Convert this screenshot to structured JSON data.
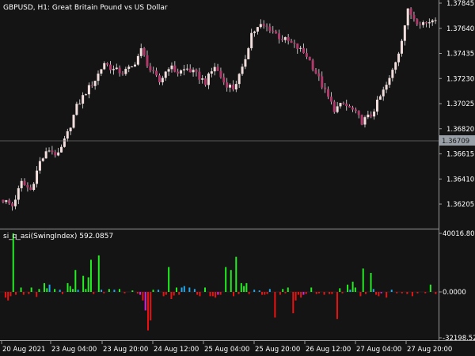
{
  "window": {
    "symbol_title": "GBPUSD, H1:  Great Britain Pound vs US Dollar",
    "indicator_title": "si_q_asi(SwingIndex) 592.0857"
  },
  "colors": {
    "background": "#141414",
    "separator": "#9a9a9a",
    "bull_candle": "#f3dede",
    "bear_candle": "#b0386a",
    "wick": "#e8e8e8",
    "current_price_box": "#9aa0a8",
    "hist_green": "#22ee22",
    "hist_red": "#ee1111",
    "hist_magenta": "#dd22dd",
    "hist_blue": "#22a8ee"
  },
  "price_axis": {
    "labels": [
      "1.37845",
      "1.37640",
      "1.37435",
      "1.37230",
      "1.37025",
      "1.36820",
      "1.36615",
      "1.36410",
      "1.36205"
    ],
    "current_price": "1.36709"
  },
  "indicator_axis": {
    "labels": [
      "40016.80",
      "0.0000",
      "-32198.52"
    ]
  },
  "time_axis": {
    "labels": [
      "20 Aug 2021",
      "23 Aug 04:00",
      "23 Aug 20:00",
      "24 Aug 12:00",
      "25 Aug 04:00",
      "25 Aug 20:00",
      "26 Aug 12:00",
      "27 Aug 04:00",
      "27 Aug 20:00"
    ]
  },
  "chart_data": [
    {
      "type": "candlestick",
      "title": "GBPUSD, H1: Great Britain Pound vs US Dollar",
      "ylim": [
        1.3608,
        1.379
      ],
      "y_ticks": [
        1.37845,
        1.3764,
        1.37435,
        1.3723,
        1.37025,
        1.3682,
        1.36615,
        1.3641,
        1.36205
      ],
      "current_price": 1.36709,
      "close_path": [
        [
          0,
          1.3624
        ],
        [
          3,
          1.3619
        ],
        [
          6,
          1.3638
        ],
        [
          9,
          1.3632
        ],
        [
          12,
          1.3655
        ],
        [
          15,
          1.3665
        ],
        [
          18,
          1.366
        ],
        [
          21,
          1.3678
        ],
        [
          24,
          1.37
        ],
        [
          27,
          1.3712
        ],
        [
          30,
          1.3722
        ],
        [
          33,
          1.3736
        ],
        [
          36,
          1.373
        ],
        [
          39,
          1.3728
        ],
        [
          42,
          1.3732
        ],
        [
          45,
          1.3746
        ],
        [
          48,
          1.373
        ],
        [
          51,
          1.372
        ],
        [
          54,
          1.3733
        ],
        [
          57,
          1.3728
        ],
        [
          60,
          1.3731
        ],
        [
          63,
          1.3726
        ],
        [
          66,
          1.372
        ],
        [
          69,
          1.3733
        ],
        [
          72,
          1.372
        ],
        [
          75,
          1.3715
        ],
        [
          78,
          1.373
        ],
        [
          81,
          1.376
        ],
        [
          84,
          1.3766
        ],
        [
          87,
          1.3764
        ],
        [
          90,
          1.3757
        ],
        [
          93,
          1.3753
        ],
        [
          96,
          1.3748
        ],
        [
          99,
          1.3742
        ],
        [
          102,
          1.3728
        ],
        [
          105,
          1.3712
        ],
        [
          108,
          1.3698
        ],
        [
          111,
          1.3702
        ],
        [
          114,
          1.3697
        ],
        [
          117,
          1.3688
        ],
        [
          120,
          1.3693
        ],
        [
          123,
          1.3708
        ],
        [
          126,
          1.3722
        ],
        [
          129,
          1.3745
        ],
        [
          132,
          1.3778
        ],
        [
          135,
          1.377
        ],
        [
          138,
          1.3768
        ],
        [
          141,
          1.3773
        ]
      ],
      "candle_count": 142
    },
    {
      "type": "bar",
      "title": "si_q_asi(SwingIndex) 592.0857",
      "ylim": [
        -32198.52,
        40016.8
      ],
      "y_ticks": [
        40016.8,
        0.0,
        -32198.52
      ],
      "bars": [
        [
          1,
          -4000,
          "red"
        ],
        [
          2,
          -6000,
          "red"
        ],
        [
          3,
          -3000,
          "red"
        ],
        [
          4,
          40016,
          "green"
        ],
        [
          5,
          -2000,
          "red"
        ],
        [
          7,
          3000,
          "green"
        ],
        [
          8,
          -2000,
          "red"
        ],
        [
          10,
          -1500,
          "red"
        ],
        [
          11,
          3000,
          "green"
        ],
        [
          13,
          -3500,
          "red"
        ],
        [
          14,
          2000,
          "green"
        ],
        [
          16,
          6000,
          "green"
        ],
        [
          17,
          2500,
          "green"
        ],
        [
          18,
          5000,
          "blue"
        ],
        [
          20,
          2000,
          "green"
        ],
        [
          22,
          1500,
          "blue"
        ],
        [
          23,
          -1500,
          "red"
        ],
        [
          25,
          6000,
          "green"
        ],
        [
          26,
          4000,
          "green"
        ],
        [
          27,
          2000,
          "green"
        ],
        [
          28,
          15000,
          "green"
        ],
        [
          29,
          1500,
          "blue"
        ],
        [
          31,
          11000,
          "green"
        ],
        [
          32,
          2000,
          "green"
        ],
        [
          33,
          10000,
          "green"
        ],
        [
          34,
          22000,
          "green"
        ],
        [
          35,
          -1500,
          "red"
        ],
        [
          37,
          25000,
          "green"
        ],
        [
          38,
          1500,
          "blue"
        ],
        [
          39,
          -1000,
          "red"
        ],
        [
          41,
          2000,
          "green"
        ],
        [
          43,
          1500,
          "blue"
        ],
        [
          45,
          2000,
          "green"
        ],
        [
          47,
          -1000,
          "red"
        ],
        [
          50,
          1000,
          "green"
        ],
        [
          52,
          -1200,
          "red"
        ],
        [
          53,
          -2000,
          "magenta"
        ],
        [
          54,
          -6000,
          "red"
        ],
        [
          55,
          -13000,
          "magenta"
        ],
        [
          56,
          -27000,
          "red"
        ],
        [
          57,
          -20000,
          "red"
        ],
        [
          58,
          1500,
          "green"
        ],
        [
          60,
          1500,
          "blue"
        ],
        [
          62,
          -3000,
          "red"
        ],
        [
          63,
          -2000,
          "red"
        ],
        [
          64,
          17000,
          "green"
        ],
        [
          65,
          -5000,
          "red"
        ],
        [
          66,
          -2500,
          "red"
        ],
        [
          67,
          3000,
          "green"
        ],
        [
          68,
          -2000,
          "red"
        ],
        [
          69,
          3000,
          "blue"
        ],
        [
          70,
          4000,
          "blue"
        ],
        [
          72,
          3000,
          "blue"
        ],
        [
          74,
          2000,
          "blue"
        ],
        [
          75,
          -2000,
          "red"
        ],
        [
          76,
          -3000,
          "red"
        ],
        [
          78,
          3000,
          "green"
        ],
        [
          80,
          -3000,
          "red"
        ],
        [
          81,
          -3000,
          "red"
        ],
        [
          82,
          -4000,
          "red"
        ],
        [
          83,
          -2000,
          "magenta"
        ],
        [
          84,
          -2000,
          "red"
        ],
        [
          86,
          17000,
          "green"
        ],
        [
          88,
          15000,
          "green"
        ],
        [
          89,
          -3000,
          "red"
        ],
        [
          90,
          24000,
          "green"
        ],
        [
          91,
          -1500,
          "red"
        ],
        [
          92,
          6000,
          "green"
        ],
        [
          93,
          4000,
          "green"
        ],
        [
          94,
          6000,
          "green"
        ],
        [
          95,
          -1500,
          "red"
        ],
        [
          97,
          1500,
          "blue"
        ],
        [
          99,
          1000,
          "blue"
        ],
        [
          100,
          -2000,
          "red"
        ],
        [
          101,
          -2000,
          "red"
        ],
        [
          102,
          -1500,
          "red"
        ],
        [
          103,
          2000,
          "blue"
        ],
        [
          105,
          -18000,
          "red"
        ],
        [
          107,
          -2000,
          "red"
        ],
        [
          108,
          2000,
          "green"
        ],
        [
          109,
          -1000,
          "red"
        ],
        [
          110,
          3000,
          "green"
        ],
        [
          112,
          -15000,
          "red"
        ],
        [
          113,
          -6000,
          "red"
        ],
        [
          114,
          -2000,
          "red"
        ],
        [
          115,
          -4000,
          "red"
        ],
        [
          116,
          -2000,
          "magenta"
        ],
        [
          117,
          -1500,
          "red"
        ],
        [
          119,
          3000,
          "green"
        ],
        [
          121,
          -1500,
          "red"
        ],
        [
          122,
          -1000,
          "red"
        ],
        [
          124,
          -2000,
          "red"
        ],
        [
          126,
          -1500,
          "red"
        ],
        [
          127,
          -1500,
          "red"
        ],
        [
          129,
          -19000,
          "red"
        ],
        [
          130,
          2500,
          "green"
        ],
        [
          131,
          -1000,
          "red"
        ],
        [
          133,
          5000,
          "green"
        ],
        [
          134,
          1500,
          "blue"
        ],
        [
          135,
          7000,
          "green"
        ],
        [
          136,
          3000,
          "green"
        ],
        [
          138,
          -3000,
          "red"
        ],
        [
          139,
          16000,
          "green"
        ],
        [
          140,
          -1500,
          "red"
        ],
        [
          142,
          13000,
          "green"
        ],
        [
          143,
          2000,
          "blue"
        ],
        [
          144,
          -2000,
          "red"
        ],
        [
          145,
          -3000,
          "red"
        ],
        [
          146,
          -1000,
          "magenta"
        ],
        [
          148,
          -4000,
          "red"
        ],
        [
          150,
          1500,
          "blue"
        ],
        [
          152,
          -1000,
          "red"
        ],
        [
          154,
          -1000,
          "red"
        ],
        [
          156,
          -1500,
          "red"
        ],
        [
          158,
          -3000,
          "red"
        ],
        [
          160,
          -1000,
          "red"
        ],
        [
          163,
          -1000,
          "red"
        ],
        [
          165,
          5000,
          "green"
        ],
        [
          167,
          -1500,
          "red"
        ]
      ],
      "bar_count": 168
    }
  ]
}
